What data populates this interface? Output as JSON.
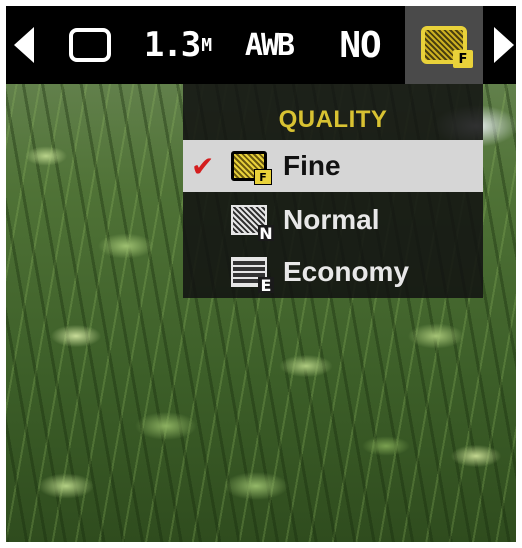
{
  "toolbar": {
    "resolution": "1.3",
    "resolution_unit": "M",
    "white_balance": "AWB",
    "flash": "NO",
    "selected_setting_icon": "quality-fine-icon"
  },
  "quality_menu": {
    "title": "QUALITY",
    "selected": "Fine",
    "items": [
      {
        "label": "Fine",
        "badge": "F",
        "checked": true
      },
      {
        "label": "Normal",
        "badge": "N",
        "checked": false
      },
      {
        "label": "Economy",
        "badge": "E",
        "checked": false
      }
    ]
  },
  "colors": {
    "accent": "#d8c232",
    "check": "#d41e1e",
    "selected_row": "#d6d6d6"
  }
}
